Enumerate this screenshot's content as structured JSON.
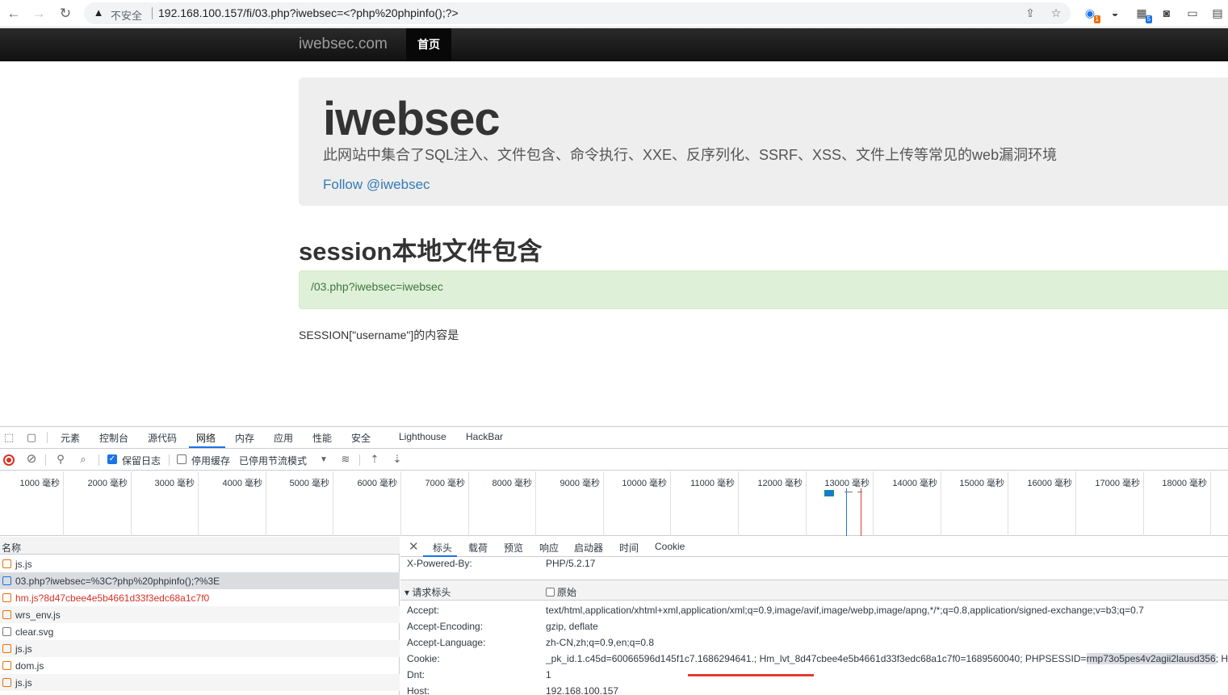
{
  "browser": {
    "insecure_label": "不安全",
    "url": "192.168.100.157/fi/03.php?iwebsec=<?php%20phpinfo();?>",
    "ext_badges": [
      "1",
      "5"
    ]
  },
  "site": {
    "brand": "iwebsec.com",
    "nav_home": "首页",
    "jumbo_title": "iwebsec",
    "jumbo_lead": "此网站中集合了SQL注入、文件包含、命令执行、XXE、反序列化、SSRF、XSS、文件上传等常见的web漏洞环境",
    "follow_link": "Follow @iwebsec",
    "page_title": "session本地文件包含",
    "alert_link": "/03.php?iwebsec=iwebsec",
    "session_text": "SESSION[\"username\"]的内容是"
  },
  "devtools": {
    "tabs": [
      "元素",
      "控制台",
      "源代码",
      "网络",
      "内存",
      "应用",
      "性能",
      "安全",
      "Lighthouse",
      "HackBar"
    ],
    "active_tab": "网络",
    "toolbar": {
      "preserve_log": "保留日志",
      "disable_cache": "停用缓存",
      "throttle": "已停用节流模式"
    },
    "timeline_ticks": [
      "1000 毫秒",
      "2000 毫秒",
      "3000 毫秒",
      "4000 毫秒",
      "5000 毫秒",
      "6000 毫秒",
      "7000 毫秒",
      "8000 毫秒",
      "9000 毫秒",
      "10000 毫秒",
      "11000 毫秒",
      "12000 毫秒",
      "13000 毫秒",
      "14000 毫秒",
      "15000 毫秒",
      "16000 毫秒",
      "17000 毫秒",
      "18000 毫秒"
    ],
    "list_header": "名称",
    "requests": [
      {
        "name": "js.js",
        "type": "script"
      },
      {
        "name": "03.php?iwebsec=%3C?php%20phpinfo();?%3E",
        "type": "doc"
      },
      {
        "name": "hm.js?8d47cbee4e5b4661d33f3edc68a1c7f0",
        "type": "script"
      },
      {
        "name": "wrs_env.js",
        "type": "script"
      },
      {
        "name": "clear.svg",
        "type": "img"
      },
      {
        "name": "js.js",
        "type": "script"
      },
      {
        "name": "dom.js",
        "type": "script"
      },
      {
        "name": "js.js",
        "type": "script"
      }
    ],
    "detail_tabs": [
      "标头",
      "载荷",
      "预览",
      "响应",
      "启动器",
      "时间",
      "Cookie"
    ],
    "response_header": {
      "name": "X-Powered-By:",
      "value": "PHP/5.2.17"
    },
    "request_section_title": "请求标头",
    "raw_label": "原始",
    "request_headers": [
      {
        "name": "Accept:",
        "value": "text/html,application/xhtml+xml,application/xml;q=0.9,image/avif,image/webp,image/apng,*/*;q=0.8,application/signed-exchange;v=b3;q=0.7"
      },
      {
        "name": "Accept-Encoding:",
        "value": "gzip, deflate"
      },
      {
        "name": "Accept-Language:",
        "value": "zh-CN,zh;q=0.9,en;q=0.8"
      },
      {
        "name": "Cookie:",
        "value": "_pk_id.1.c45d=60066596d145f1c7.1686294641.; Hm_lvt_8d47cbee4e5b4661d33f3edc68a1c7f0=1689560040; PHPSESSID=",
        "highlight": "rmp73o5pes4v2agii2lausd356",
        "tail": "; H"
      },
      {
        "name": "Dnt:",
        "value": "1"
      },
      {
        "name": "Host:",
        "value": "192.168.100.157"
      }
    ]
  }
}
